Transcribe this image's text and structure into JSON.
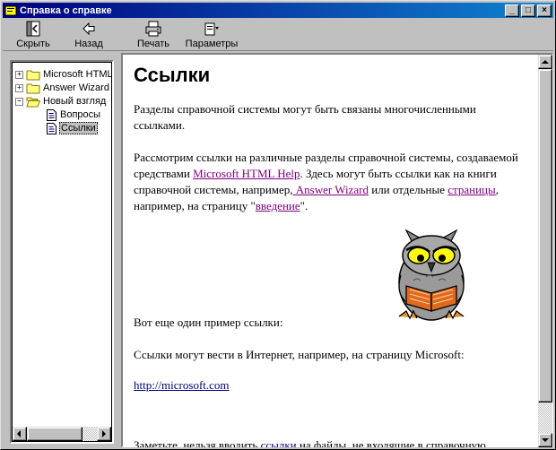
{
  "window": {
    "title": "Справка о справке",
    "controls": {
      "minimize": "_",
      "maximize": "□",
      "close": "×"
    }
  },
  "toolbar": {
    "hide_label": "Скрыть",
    "back_label": "Назад",
    "print_label": "Печать",
    "options_label": "Параметры"
  },
  "tree": {
    "items": [
      {
        "label": "Microsoft HTML",
        "expander": "+",
        "type": "folder"
      },
      {
        "label": "Answer Wizard",
        "expander": "+",
        "type": "folder"
      },
      {
        "label": "Новый взгляд",
        "expander": "−",
        "type": "folder-open"
      },
      {
        "label": "Вопросы",
        "type": "page"
      },
      {
        "label": "Ссылки",
        "type": "page",
        "selected": true
      }
    ]
  },
  "content": {
    "heading": "Ссылки",
    "p1": "Разделы справочной системы могут быть связаны многочисленными ссылками.",
    "p2": {
      "t1": "Рассмотрим ссылки на различные разделы справочной системы, создаваемой средствами ",
      "link1": "Microsoft HTML Help",
      "t2": ".  Здесь могут быть ссылки как на книги справочной системы, например,",
      "link2": " Answer Wizard",
      "t3": " или отдельные ",
      "link3": "страницы",
      "t4": ", например, на страницу \"",
      "link4": "введение",
      "t5": "\"."
    },
    "p3": "Вот еще один пример ссылки:",
    "p4": "Ссылки могут вести в Интернет, например, на страницу Microsoft:",
    "url_link": "http://microsoft.com",
    "p5": {
      "t1": "Заметьте, нельзя вводить ",
      "link": "ссылки",
      "t2": " на файлы, не входящие в справочную"
    }
  }
}
